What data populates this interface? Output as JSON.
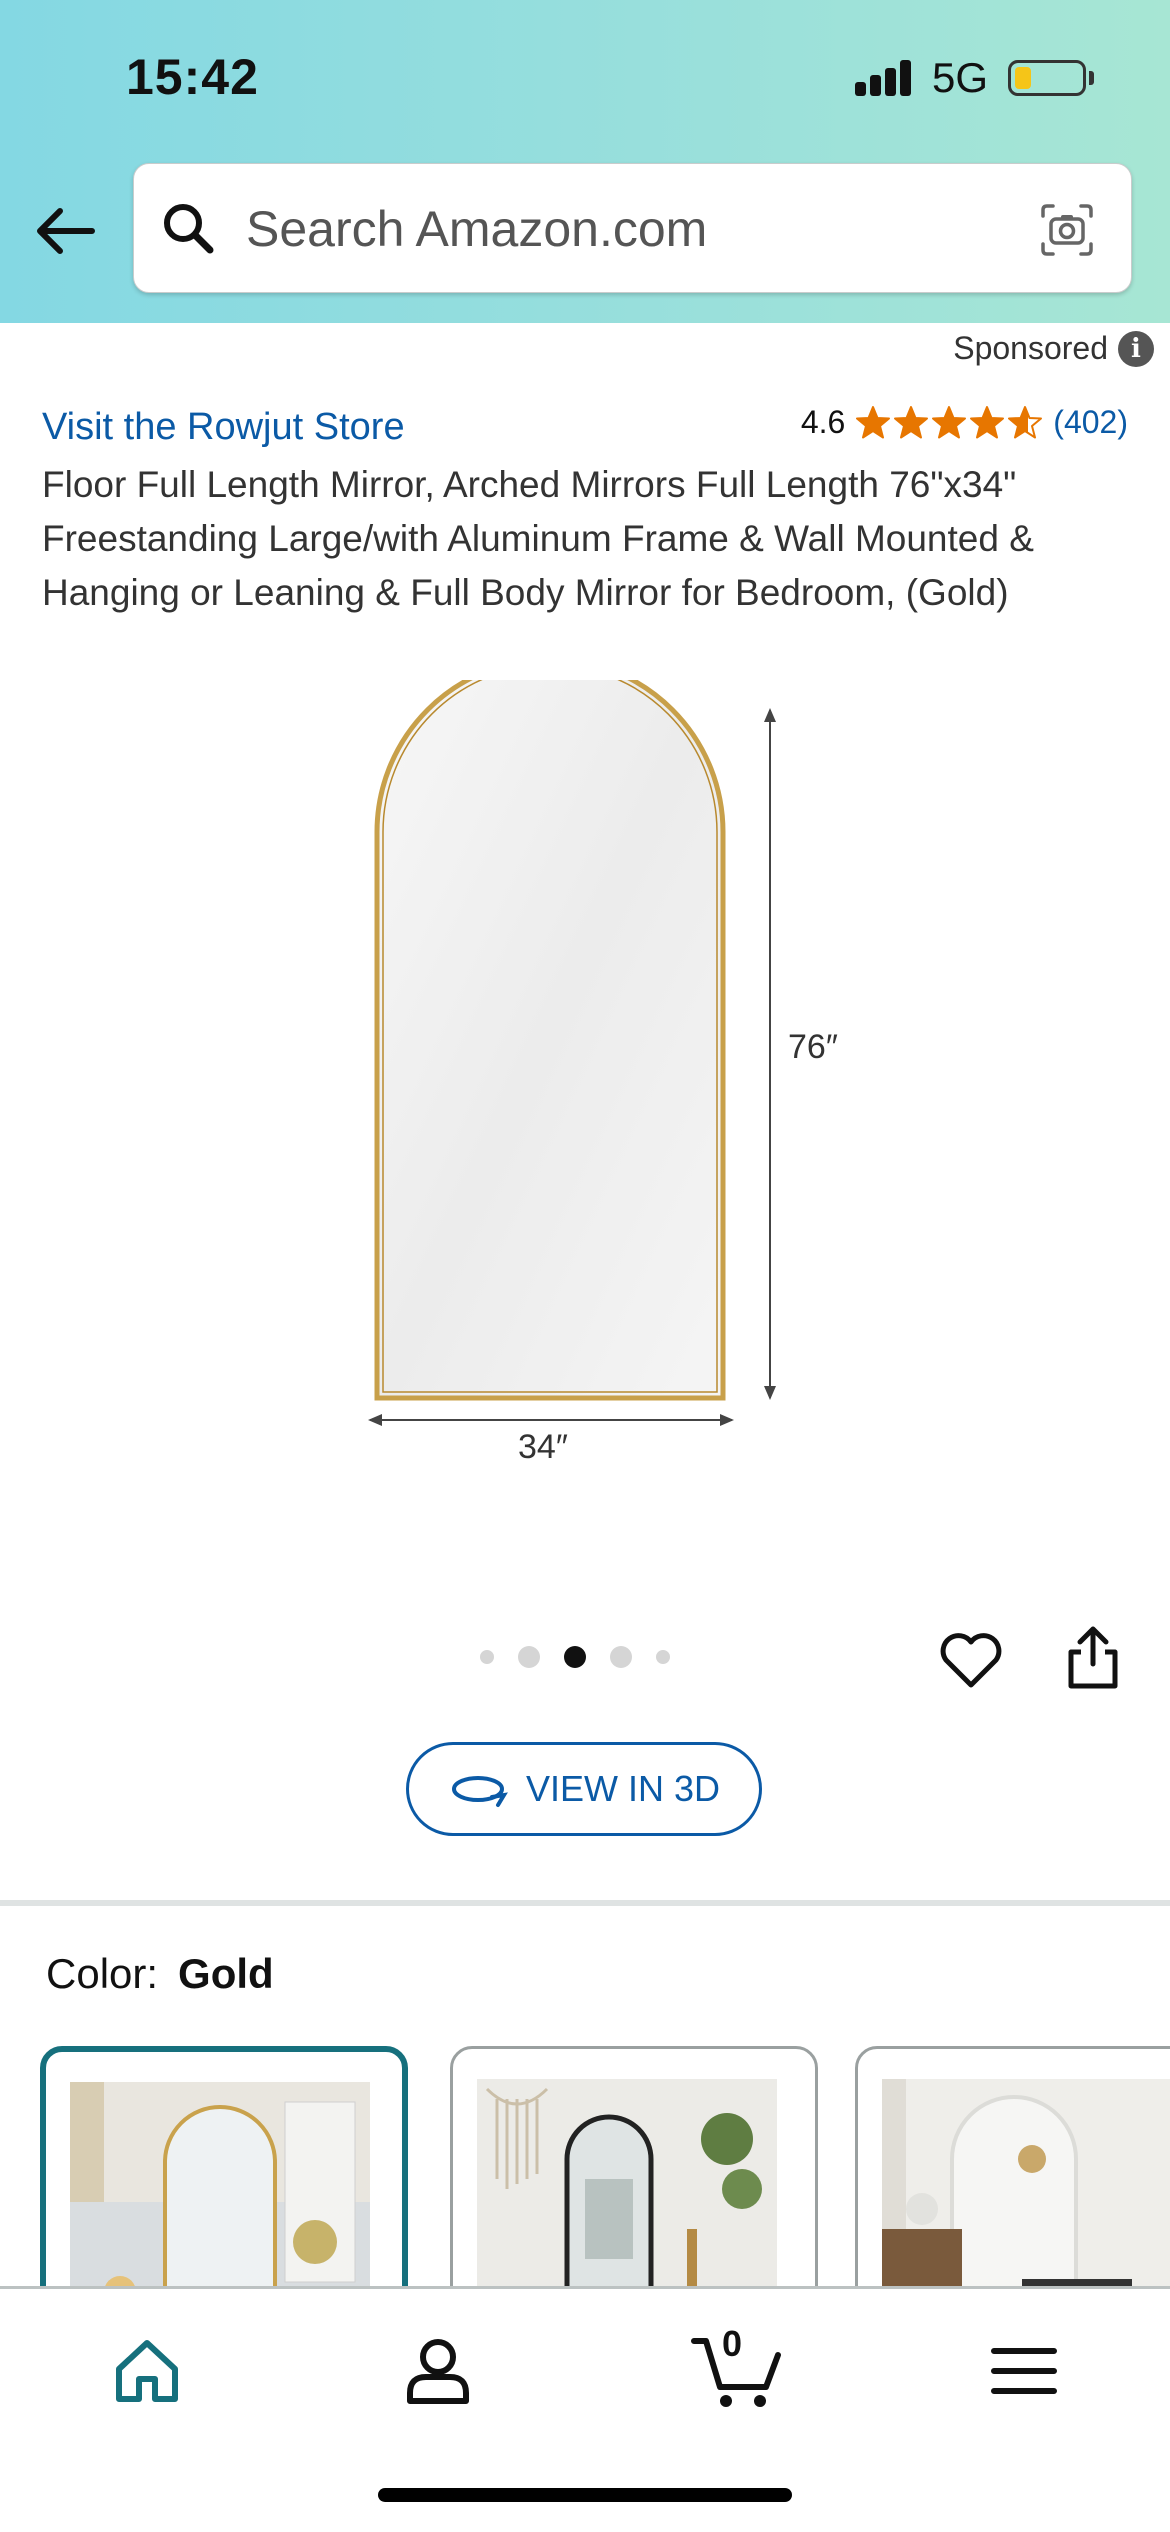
{
  "status_bar": {
    "time": "15:42",
    "network": "5G",
    "battery_level": 0.25
  },
  "search": {
    "placeholder": "Search Amazon.com",
    "value": ""
  },
  "sponsored": {
    "label": "Sponsored"
  },
  "product": {
    "store_link": "Visit the Rowjut Store",
    "rating_value": "4.6",
    "rating_stars": 4.6,
    "review_count": "(402)",
    "title": "Floor Full Length Mirror, Arched Mirrors Full Length 76\"x34\" Freestanding Large/with Aluminum Frame & Wall Mounted & Hanging or Leaning & Full Body Mirror for Bedroom, (Gold)",
    "image": {
      "height_label": "76″",
      "width_label": "34″"
    },
    "carousel": {
      "total": 5,
      "active_index": 2
    }
  },
  "actions": {
    "view_3d_label": "VIEW IN 3D"
  },
  "color": {
    "label": "Color:",
    "value": "Gold",
    "selected_index": 0
  },
  "bottom_nav": {
    "items": [
      "home-icon",
      "account-icon",
      "cart-icon",
      "menu-icon"
    ],
    "cart_count": "0"
  },
  "colors": {
    "accent": "#16707d",
    "link": "#0b5aa6",
    "star": "#e77600"
  }
}
